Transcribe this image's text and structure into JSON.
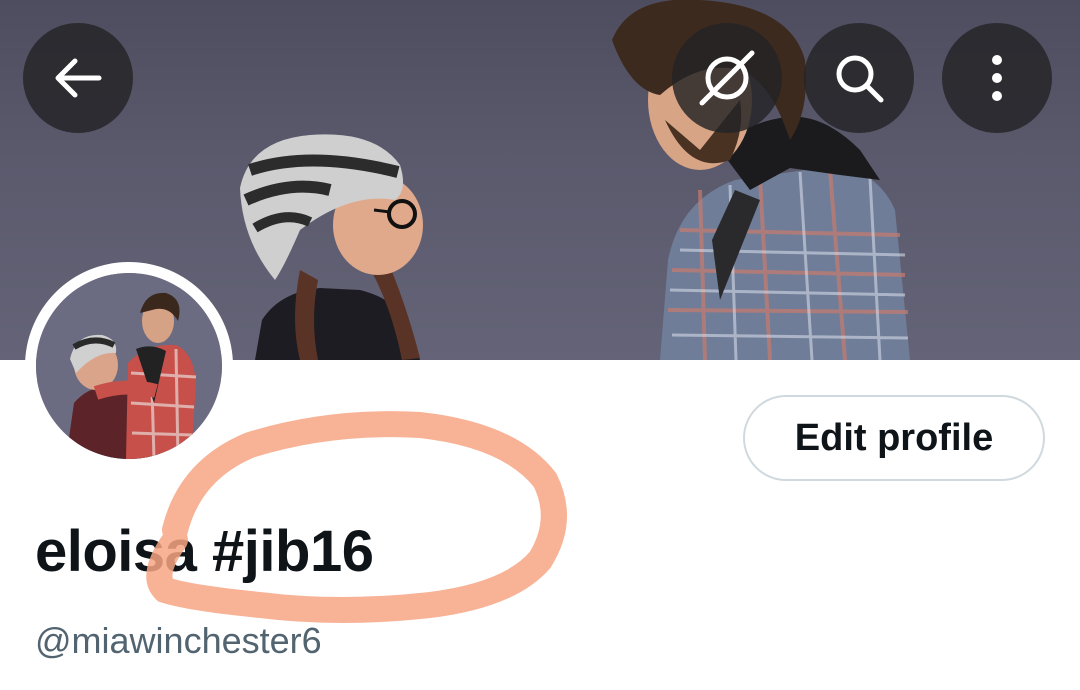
{
  "header": {
    "back_icon": "arrow-left-icon",
    "grok_icon": "slashed-circle-icon",
    "search_icon": "search-icon",
    "more_icon": "more-vertical-icon"
  },
  "profile": {
    "display_name": "eloisa #jib16",
    "handle": "@miawinchester6",
    "edit_button_label": "Edit profile"
  },
  "colors": {
    "name": "#0f1419",
    "handle": "#536471",
    "button_border": "#cfd9de",
    "annotation": "#f7a583"
  }
}
